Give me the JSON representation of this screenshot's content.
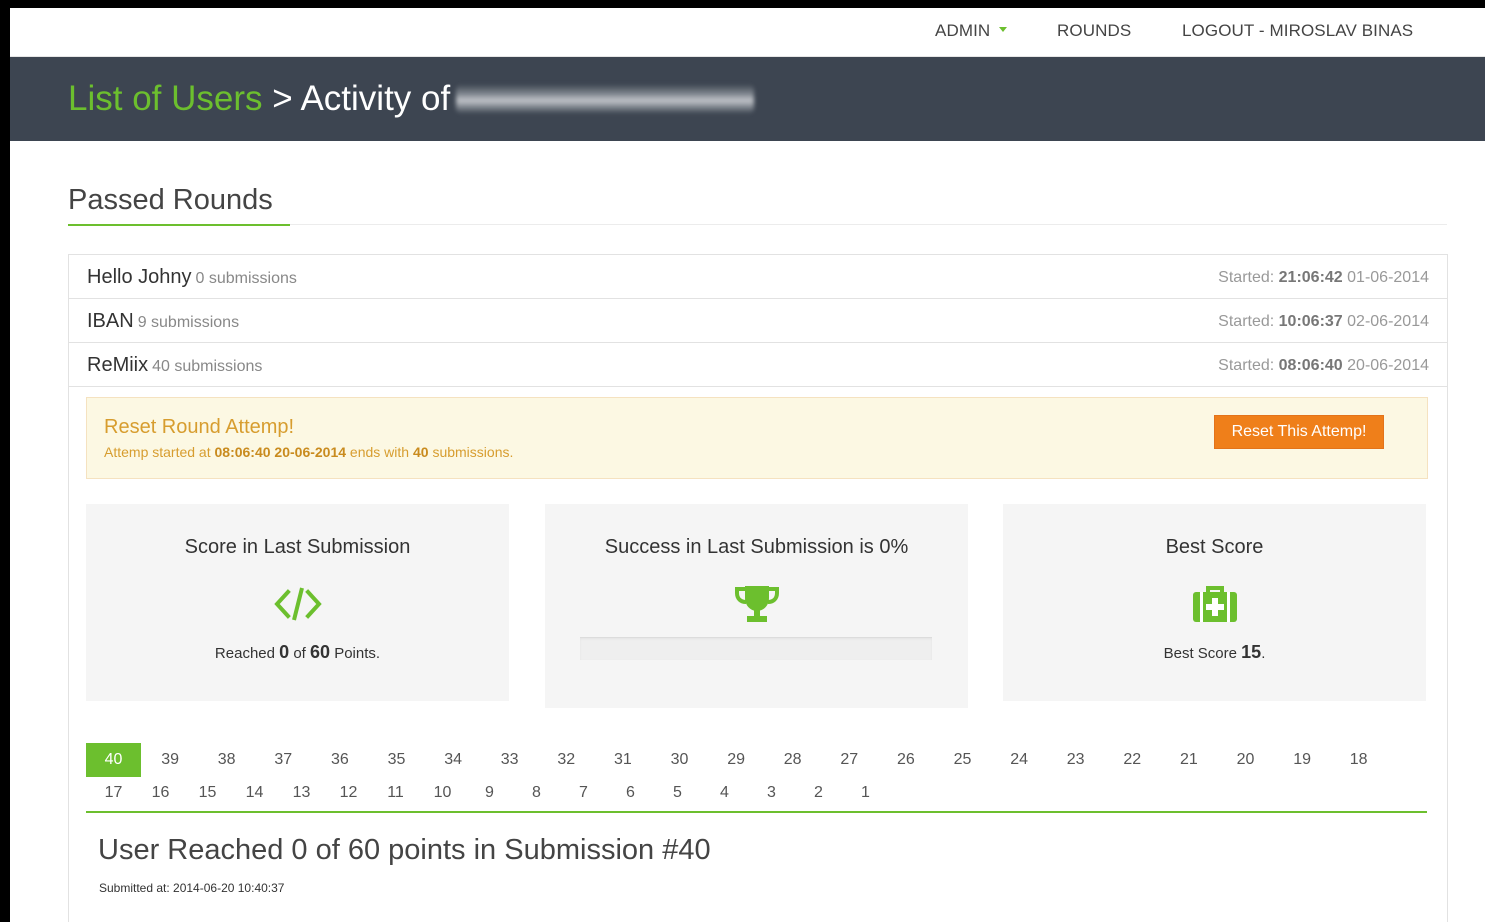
{
  "nav": {
    "admin": "ADMIN",
    "rounds": "ROUNDS",
    "logout": "LOGOUT - MIROSLAV BINAS"
  },
  "header": {
    "crumb_link": "List of Users",
    "crumb_rest": " > Activity of"
  },
  "section": {
    "title": "Passed Rounds"
  },
  "rounds": [
    {
      "name": "Hello Johny",
      "subs": "0 submissions",
      "started_label": "Started:",
      "time": "21:06:42",
      "date": "01-06-2014"
    },
    {
      "name": "IBAN",
      "subs": "9 submissions",
      "started_label": "Started:",
      "time": "10:06:37",
      "date": "02-06-2014"
    },
    {
      "name": "ReMiix",
      "subs": "40 submissions",
      "started_label": "Started:",
      "time": "08:06:40",
      "date": "20-06-2014"
    }
  ],
  "alert": {
    "title": "Reset Round Attemp!",
    "t1": "Attemp started at ",
    "started": "08:06:40 20-06-2014",
    "t2": " ends with ",
    "count": "40",
    "t3": " submissions.",
    "button": "Reset This Attemp!"
  },
  "cards": {
    "score": {
      "title": "Score in Last Submission",
      "icon": "code-icon",
      "t1": "Reached ",
      "reached": "0",
      "t2": " of ",
      "total": "60",
      "t3": " Points."
    },
    "success": {
      "title": "Success in Last Submission is 0%",
      "icon": "trophy-icon",
      "progress": 0
    },
    "best": {
      "title": "Best Score",
      "icon": "medkit-icon",
      "t1": "Best Score ",
      "value": "15",
      "t2": "."
    }
  },
  "pager": {
    "pages": [
      "40",
      "39",
      "38",
      "37",
      "36",
      "35",
      "34",
      "33",
      "32",
      "31",
      "30",
      "29",
      "28",
      "27",
      "26",
      "25",
      "24",
      "23",
      "22",
      "21",
      "20",
      "19",
      "18",
      "17",
      "16",
      "15",
      "14",
      "13",
      "12",
      "11",
      "10",
      "9",
      "8",
      "7",
      "6",
      "5",
      "4",
      "3",
      "2",
      "1"
    ],
    "active": "40"
  },
  "result": {
    "title": "User Reached 0 of 60 points in Submission #40",
    "submitted": "Submitted at: 2014-06-20 10:40:37"
  },
  "colors": {
    "accent": "#6cbf2e",
    "header_bg": "#3d4551",
    "warning": "#ef7f1a"
  }
}
